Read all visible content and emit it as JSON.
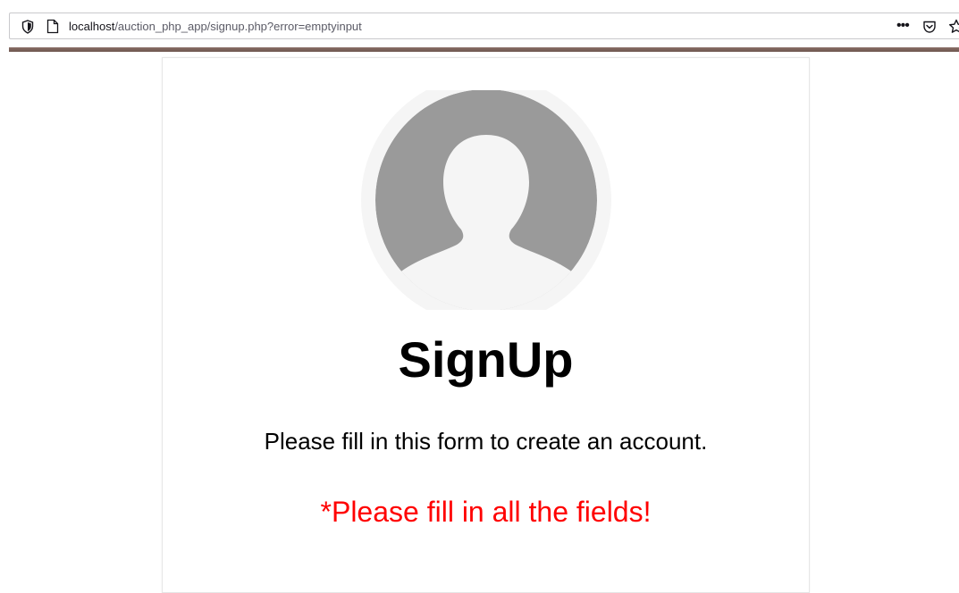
{
  "browser": {
    "url_host": "localhost",
    "url_path": "/auction_php_app/signup.php?error=emptyinput",
    "icons": [
      "shield-icon",
      "page-icon",
      "more-icon",
      "pocket-icon",
      "star-icon"
    ]
  },
  "form": {
    "title": "SignUp",
    "subtitle": "Please fill in this form to create an account.",
    "error_message": "*Please fill in all the fields!",
    "avatar_icon": "user-avatar-icon"
  },
  "colors": {
    "error": "#ff0000",
    "avatar_fill": "#9a9a9a",
    "avatar_bg": "#f5f5f5",
    "strip": "#7a625a"
  }
}
